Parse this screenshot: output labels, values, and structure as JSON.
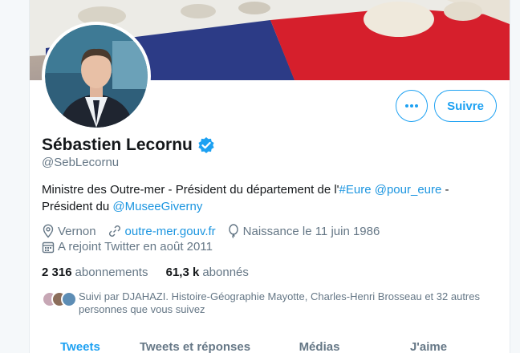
{
  "profile": {
    "name": "Sébastien Lecornu",
    "handle": "@SebLecornu",
    "bio": {
      "part1": "Ministre des Outre-mer - Président du département de l'",
      "hashtag": "#Eure",
      "mention1": "@pour_eure",
      "part2": " - Président du ",
      "mention2": "@MuseeGiverny"
    },
    "location": "Vernon",
    "website": "outre-mer.gouv.fr",
    "birthday": "Naissance le 11 juin 1986",
    "joined": "A rejoint Twitter en août 2011"
  },
  "stats": {
    "following_count": "2 316",
    "following_label": "abonnements",
    "followers_count": "61,3 k",
    "followers_label": "abonnés"
  },
  "followed_by": "Suivi par DJAHAZI. Histoire-Géographie Mayotte, Charles-Henri Brosseau et 32 autres personnes que vous suivez",
  "actions": {
    "follow_label": "Suivre"
  },
  "tabs": [
    "Tweets",
    "Tweets et réponses",
    "Médias",
    "J'aime"
  ],
  "icons": {
    "more": "more-dots-icon",
    "verified": "verified-badge-icon",
    "location": "location-pin-icon",
    "link": "link-icon",
    "birthday": "balloon-icon",
    "calendar": "calendar-icon"
  },
  "colors": {
    "accent": "#1da1f2",
    "link": "#1b95e0",
    "muted": "#657786"
  }
}
